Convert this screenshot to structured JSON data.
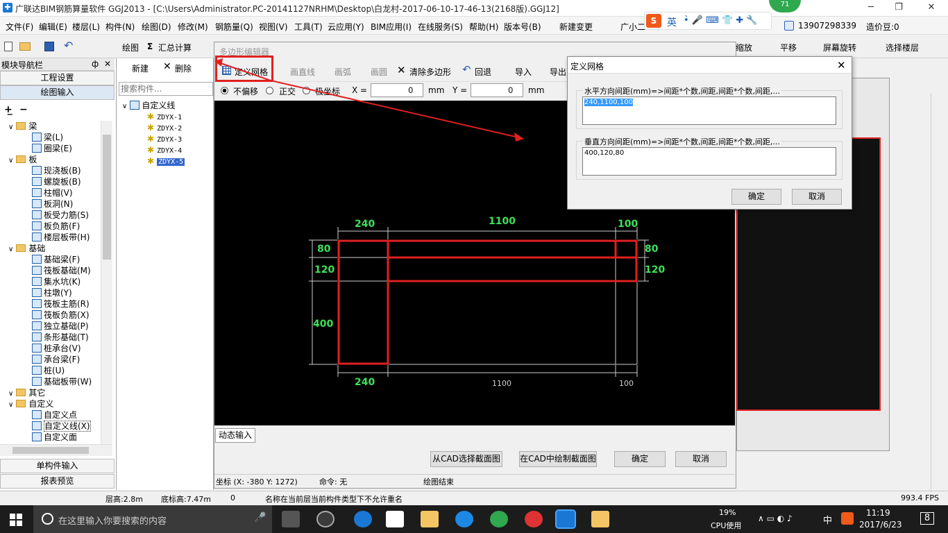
{
  "app": {
    "title": "广联达BIM钢筋算量软件 GGJ2013 - [C:\\Users\\Administrator.PC-20141127NRHM\\Desktop\\白龙村-2017-06-10-17-46-13(2168版).GGJ12]",
    "badge": "71",
    "ime": "英",
    "phone": "13907298339",
    "price": "造价豆:0"
  },
  "menu": [
    "文件(F)",
    "编辑(E)",
    "楼层(L)",
    "构件(N)",
    "绘图(D)",
    "修改(M)",
    "钢筋量(Q)",
    "视图(V)",
    "工具(T)",
    "云应用(Y)",
    "BIM应用(I)",
    "在线服务(S)",
    "帮助(H)",
    "版本号(B)",
    "新建变更",
    "广小二"
  ],
  "toolbar": {
    "draw": "绘图",
    "sum": "汇总计算",
    "zoom": "缩放",
    "pan": "平移",
    "rotate": "屏幕旋转",
    "select_floor": "选择楼层"
  },
  "nav": {
    "header": "模块导航栏",
    "pin": "ф",
    "close": "✕",
    "project_settings": "工程设置",
    "drawing_input": "绘图输入",
    "single_input": "单构件输入",
    "report": "报表预览",
    "tree": [
      {
        "label": "梁",
        "level": 0,
        "type": "folder"
      },
      {
        "label": "梁(L)",
        "level": 1
      },
      {
        "label": "圈梁(E)",
        "level": 1
      },
      {
        "label": "板",
        "level": 0,
        "type": "folder"
      },
      {
        "label": "现浇板(B)",
        "level": 1
      },
      {
        "label": "螺旋板(B)",
        "level": 1
      },
      {
        "label": "柱帽(V)",
        "level": 1
      },
      {
        "label": "板洞(N)",
        "level": 1
      },
      {
        "label": "板受力筋(S)",
        "level": 1
      },
      {
        "label": "板负筋(F)",
        "level": 1
      },
      {
        "label": "楼层板带(H)",
        "level": 1
      },
      {
        "label": "基础",
        "level": 0,
        "type": "folder"
      },
      {
        "label": "基础梁(F)",
        "level": 1
      },
      {
        "label": "筏板基础(M)",
        "level": 1
      },
      {
        "label": "集水坑(K)",
        "level": 1
      },
      {
        "label": "柱墩(Y)",
        "level": 1
      },
      {
        "label": "筏板主筋(R)",
        "level": 1
      },
      {
        "label": "筏板负筋(X)",
        "level": 1
      },
      {
        "label": "独立基础(P)",
        "level": 1
      },
      {
        "label": "条形基础(T)",
        "level": 1
      },
      {
        "label": "桩承台(V)",
        "level": 1
      },
      {
        "label": "承台梁(F)",
        "level": 1
      },
      {
        "label": "桩(U)",
        "level": 1
      },
      {
        "label": "基础板带(W)",
        "level": 1
      },
      {
        "label": "其它",
        "level": 0,
        "type": "folder"
      },
      {
        "label": "自定义",
        "level": 0,
        "type": "folder"
      },
      {
        "label": "自定义点",
        "level": 1
      },
      {
        "label": "自定义线(X)",
        "level": 1
      },
      {
        "label": "自定义面",
        "level": 1
      }
    ]
  },
  "components": {
    "new": "新建",
    "delete": "删除",
    "search_placeholder": "搜索构件...",
    "root": "自定义线",
    "items": [
      "ZDYX-1",
      "ZDYX-2",
      "ZDYX-3",
      "ZDYX-4",
      "ZDYX-5"
    ]
  },
  "editor": {
    "title": "多边形编辑器",
    "define_grid": "定义网格",
    "draw_line": "画直线",
    "draw_arc": "画弧",
    "draw_circle": "画圆",
    "clear_polygon": "清除多边形",
    "undo": "回退",
    "import": "导入",
    "export": "导出",
    "no_offset": "不偏移",
    "ortho": "正交",
    "polar": "极坐标",
    "x_label": "X =",
    "x_value": "0",
    "y_label": "Y =",
    "y_value": "0",
    "unit": "mm",
    "dynamic_input": "动态输入",
    "cad_select": "从CAD选择截面图",
    "cad_draw": "在CAD中绘制截面图",
    "ok": "确定",
    "cancel": "取消",
    "coord": "坐标 (X: -380 Y: 1272)",
    "command": "命令: 无",
    "draw_end": "绘图结束",
    "dims": {
      "top": [
        "240",
        "1100",
        "100"
      ],
      "bottom": [
        "240",
        "1100",
        "100"
      ],
      "right": [
        "80",
        "120"
      ],
      "left": [
        "80",
        "120",
        "400"
      ]
    }
  },
  "dialog": {
    "title": "定义网格",
    "h_label": "水平方向间距(mm)=>间距*个数,间距,间距*个数,间距,...",
    "h_value": "240,1100,100",
    "v_label": "垂直方向间距(mm)=>间距*个数,间距,间距*个数,间距,...",
    "v_value": "400,120,80",
    "ok": "确定",
    "cancel": "取消"
  },
  "status": {
    "floor_height": "层高:2.8m",
    "bottom_height": "底标高:7.47m",
    "zero": "0",
    "message": "名称在当前层当前构件类型下不允许重名",
    "fps": "993.4 FPS"
  },
  "taskbar": {
    "search": "在这里输入你要搜索的内容",
    "cpu_pct": "19%",
    "cpu_label": "CPU使用",
    "lang": "中",
    "time": "11:19",
    "date": "2017/6/23",
    "notif": "8"
  },
  "colors": {
    "red": "#e02020",
    "green": "#3ee05a",
    "canvas": "#000000"
  }
}
